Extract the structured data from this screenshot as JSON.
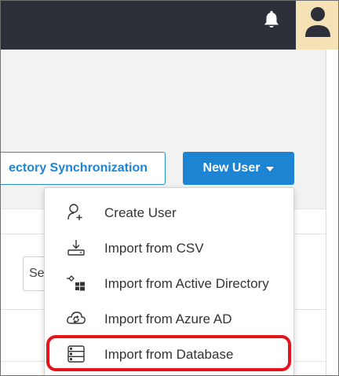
{
  "header": {
    "notification_icon": "bell-icon",
    "avatar_icon": "user-avatar-icon",
    "bar_color": "#2d3038",
    "avatar_bg": "#f4e2b6"
  },
  "toolbar": {
    "directory_sync_label": "ectory Synchronization",
    "new_user_label": "New User",
    "accent_color": "#1d84d4"
  },
  "filter": {
    "select_value": "Se"
  },
  "new_user_menu": {
    "items": [
      {
        "label": "Create User",
        "icon": "add-user-icon"
      },
      {
        "label": "Import from CSV",
        "icon": "download-tray-icon"
      },
      {
        "label": "Import from Active Directory",
        "icon": "windows-directory-icon"
      },
      {
        "label": "Import from Azure AD",
        "icon": "cloud-sync-icon"
      },
      {
        "label": "Import from Database",
        "icon": "database-server-icon"
      }
    ],
    "highlighted_item": "Import from Database",
    "highlight_color": "#e3141c"
  }
}
